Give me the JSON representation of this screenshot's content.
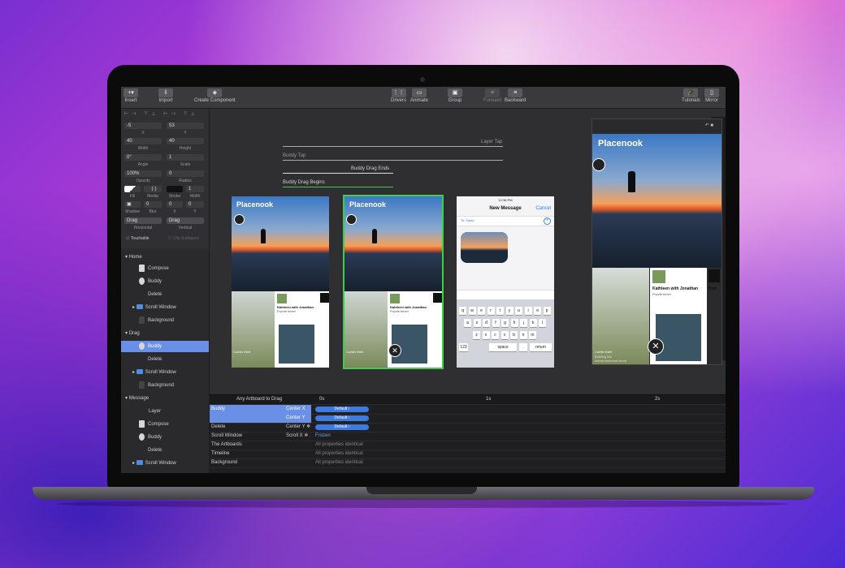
{
  "toolbar": {
    "insert": "Insert",
    "import": "Import",
    "create_component": "Create Component",
    "drivers": "Drivers",
    "animate": "Animate",
    "group": "Group",
    "forward": "Forward",
    "backward": "Backward",
    "tutorials": "Tutorials",
    "mirror": "Mirror"
  },
  "inspector": {
    "x": "-5",
    "x_label": "X",
    "y": "53",
    "y_label": "Y",
    "width": "40",
    "width_label": "Width",
    "height": "40",
    "height_label": "Height",
    "angle": "0°",
    "angle_label": "Angle",
    "scale": "1",
    "scale_label": "Scale",
    "opacity": "100%",
    "opacity_label": "Opacity",
    "radius": "0",
    "radius_label": "Radius",
    "fill_label": "Fill",
    "media_label": "Media",
    "stroke_label": "Stroke",
    "width2": "1",
    "width2_label": "Width",
    "shadow_label": "Shadow",
    "blur": "0",
    "blur_label": "Blur",
    "sx": "0",
    "sx_label": "X",
    "sy": "0",
    "sy_label": "Y",
    "horizontal": "Drag",
    "horizontal_label": "Horizontal",
    "vertical": "Drag",
    "vertical_label": "Vertical",
    "touchable": "Touchable",
    "clip": "Clip Sublayers"
  },
  "layers": {
    "home": "Home",
    "compose": "Compose",
    "buddy": "Buddy",
    "delete": "Delete",
    "scroll_window": "Scroll Window",
    "background": "Background",
    "drag": "Drag",
    "message": "Message",
    "layer": "Layer"
  },
  "canvas": {
    "conn1": "Layer Tap",
    "conn2": "Buddy Tap",
    "conn3": "Buddy Drag Ends",
    "conn4": "Buddy Drag Begins",
    "app_title": "Placenook",
    "card_name": "Kathleen with Jonathan",
    "card_sub": "Puzzle timer!",
    "card2_name": "Corbin Klett",
    "card2_sub": "Building the",
    "card2_sub2": "#dreamhomeset fundr",
    "brat": "Brat",
    "msg_time": "12:36 PM",
    "msg_title": "New Message",
    "msg_cancel": "Cancel",
    "msg_to": "To: Dylan",
    "kb_row1": [
      "q",
      "w",
      "e",
      "r",
      "t",
      "y",
      "u",
      "i",
      "o",
      "p"
    ],
    "kb_row2": [
      "a",
      "s",
      "d",
      "f",
      "g",
      "h",
      "j",
      "k",
      "l"
    ],
    "kb_row3": [
      "z",
      "x",
      "c",
      "v",
      "b",
      "n",
      "m"
    ],
    "kb_space": "space",
    "kb_return": "return",
    "kb_123": "123",
    "kb_dot": "."
  },
  "timeline": {
    "header": "Any Artboard to Drag",
    "t0": "0s",
    "t1": "1s",
    "t2": "2s",
    "rows": [
      {
        "name": "Buddy",
        "prop": "Center X",
        "val": "Default ›"
      },
      {
        "name": "",
        "prop": "Center Y",
        "val": "Default ›"
      },
      {
        "name": "Delete",
        "prop": "Center Y ❄",
        "val": "Default ›"
      },
      {
        "name": "Scroll Window",
        "prop": "Scroll X ❄",
        "val": "Frozen"
      },
      {
        "name": "The Artboards",
        "prop": "",
        "val": "All properties identical"
      },
      {
        "name": "Timeline",
        "prop": "",
        "val": "All properties identical"
      },
      {
        "name": "Background",
        "prop": "",
        "val": "All properties identical"
      }
    ]
  }
}
